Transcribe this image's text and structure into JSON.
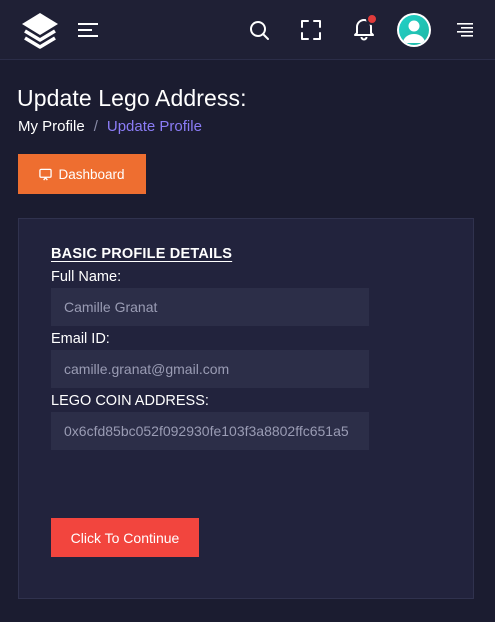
{
  "header": {
    "logo_icon": "stacked-layers-logo",
    "menu_icon": "hamburger-menu-icon",
    "search_icon": "search-icon",
    "fullscreen_icon": "fullscreen-icon",
    "notification_icon": "bell-icon",
    "profile_icon": "user-avatar-icon",
    "right_menu_icon": "right-align-menu-icon"
  },
  "page": {
    "title": "Update Lego Address:",
    "breadcrumb": {
      "home": "My Profile",
      "separator": "/",
      "current": "Update Profile"
    },
    "dashboard_button": "Dashboard"
  },
  "form": {
    "section_title": "BASIC PROFILE DETAILS",
    "full_name": {
      "label": "Full Name:",
      "value": "Camille Granat"
    },
    "email": {
      "label": "Email ID:",
      "value": "camille.granat@gmail.com"
    },
    "coin_address": {
      "label": "LEGO COIN ADDRESS:",
      "value": "0x6cfd85bc052f092930fe103f3a8802ffc651a5"
    },
    "submit_label": "Click To Continue"
  },
  "colors": {
    "background": "#1b1c30",
    "topbar": "#1f2035",
    "card": "#22233d",
    "input": "#2c2e48",
    "accent_orange": "#ee6e30",
    "accent_red": "#f2453e",
    "breadcrumb_active": "#8b7cf6",
    "avatar": "#1fd1c8"
  }
}
